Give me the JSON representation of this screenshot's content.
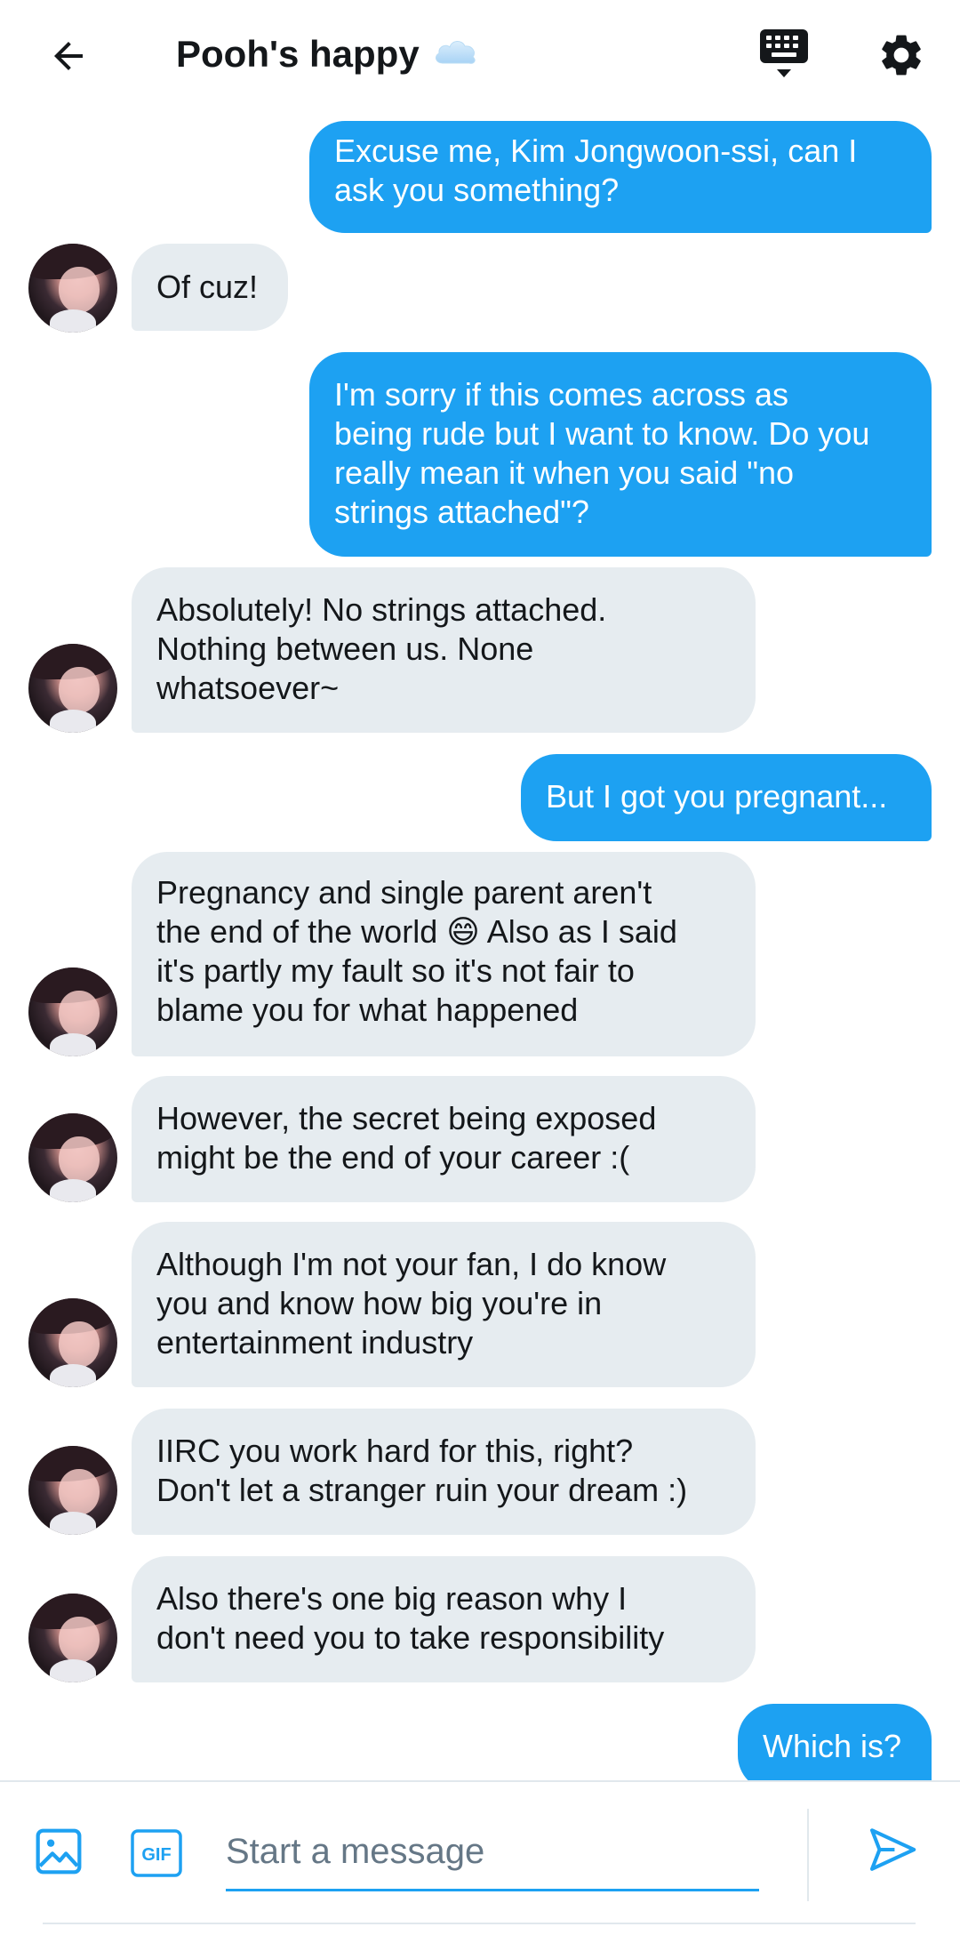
{
  "header": {
    "title": "Pooh's happy",
    "back_icon": "arrow-left-icon",
    "keyboard_icon": "keyboard-icon",
    "settings_icon": "gear-icon",
    "accent": "#1da1f2"
  },
  "messages": [
    {
      "direction": "out",
      "text": "Excuse me, Kim Jongwoon-ssi, can I\nask you something?"
    },
    {
      "direction": "in",
      "text": "Of cuz!"
    },
    {
      "direction": "out",
      "text": "I'm sorry if this comes across as\nbeing rude but I want to know. Do you\nreally mean it when you said \"no\nstrings attached\"?"
    },
    {
      "direction": "in",
      "text": "Absolutely! No strings attached.\nNothing between us. None\nwhatsoever~"
    },
    {
      "direction": "out",
      "text": "But I got you pregnant..."
    },
    {
      "direction": "in",
      "text": "Pregnancy and single parent aren't\nthe end of the world 😄 Also as I said\nit's partly my fault so it's not fair to\nblame you for what happened"
    },
    {
      "direction": "in",
      "text": "However, the secret being exposed\nmight be the end of your career :("
    },
    {
      "direction": "in",
      "text": "Although I'm not your fan, I do know\nyou and know how big you're in\nentertainment industry"
    },
    {
      "direction": "in",
      "text": "IIRC you work hard for this, right?\nDon't let a stranger ruin your dream  :)"
    },
    {
      "direction": "in",
      "text": "Also there's one big reason why I\ndon't need you to take responsibility"
    },
    {
      "direction": "out",
      "text": "Which is?"
    }
  ],
  "composer": {
    "placeholder": "Start a message",
    "value": "",
    "media_icon": "image-icon",
    "gif_label": "GIF",
    "send_icon": "send-icon"
  }
}
